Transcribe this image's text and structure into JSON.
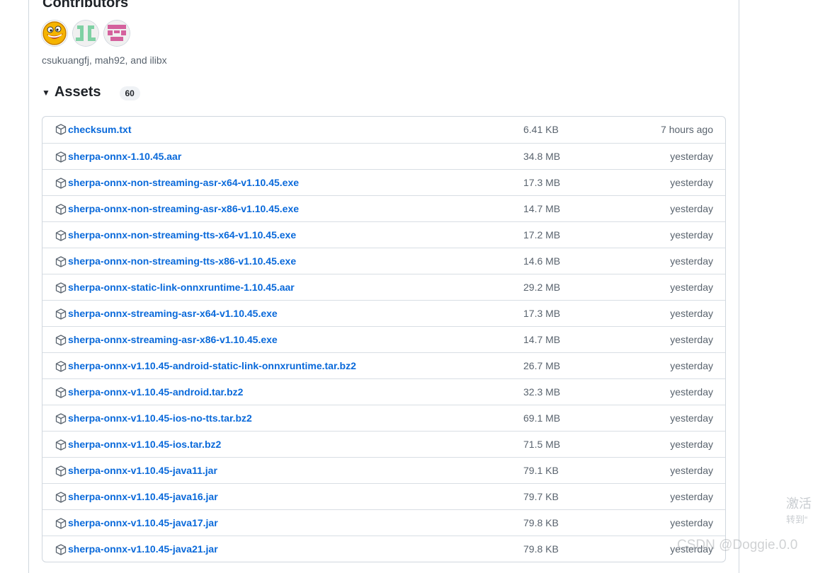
{
  "contributors": {
    "title": "Contributors",
    "names": "csukuangfj, mah92, and ilibx",
    "avatars": [
      {
        "name": "smiley-avatar",
        "color": "#f5b400"
      },
      {
        "name": "green-pattern-avatar",
        "color": "#7fd1a4"
      },
      {
        "name": "pink-pattern-avatar",
        "color": "#d4619d"
      }
    ]
  },
  "assets": {
    "title": "Assets",
    "count": "60",
    "caret_icon": "triangle-down-icon",
    "row_icon": "package-icon",
    "link_color": "#0969da",
    "items": [
      {
        "name": "checksum.txt",
        "size": "6.41 KB",
        "date": "7 hours ago"
      },
      {
        "name": "sherpa-onnx-1.10.45.aar",
        "size": "34.8 MB",
        "date": "yesterday"
      },
      {
        "name": "sherpa-onnx-non-streaming-asr-x64-v1.10.45.exe",
        "size": "17.3 MB",
        "date": "yesterday"
      },
      {
        "name": "sherpa-onnx-non-streaming-asr-x86-v1.10.45.exe",
        "size": "14.7 MB",
        "date": "yesterday"
      },
      {
        "name": "sherpa-onnx-non-streaming-tts-x64-v1.10.45.exe",
        "size": "17.2 MB",
        "date": "yesterday"
      },
      {
        "name": "sherpa-onnx-non-streaming-tts-x86-v1.10.45.exe",
        "size": "14.6 MB",
        "date": "yesterday"
      },
      {
        "name": "sherpa-onnx-static-link-onnxruntime-1.10.45.aar",
        "size": "29.2 MB",
        "date": "yesterday"
      },
      {
        "name": "sherpa-onnx-streaming-asr-x64-v1.10.45.exe",
        "size": "17.3 MB",
        "date": "yesterday"
      },
      {
        "name": "sherpa-onnx-streaming-asr-x86-v1.10.45.exe",
        "size": "14.7 MB",
        "date": "yesterday"
      },
      {
        "name": "sherpa-onnx-v1.10.45-android-static-link-onnxruntime.tar.bz2",
        "size": "26.7 MB",
        "date": "yesterday"
      },
      {
        "name": "sherpa-onnx-v1.10.45-android.tar.bz2",
        "size": "32.3 MB",
        "date": "yesterday"
      },
      {
        "name": "sherpa-onnx-v1.10.45-ios-no-tts.tar.bz2",
        "size": "69.1 MB",
        "date": "yesterday"
      },
      {
        "name": "sherpa-onnx-v1.10.45-ios.tar.bz2",
        "size": "71.5 MB",
        "date": "yesterday"
      },
      {
        "name": "sherpa-onnx-v1.10.45-java11.jar",
        "size": "79.1 KB",
        "date": "yesterday"
      },
      {
        "name": "sherpa-onnx-v1.10.45-java16.jar",
        "size": "79.7 KB",
        "date": "yesterday"
      },
      {
        "name": "sherpa-onnx-v1.10.45-java17.jar",
        "size": "79.8 KB",
        "date": "yesterday"
      },
      {
        "name": "sherpa-onnx-v1.10.45-java21.jar",
        "size": "79.8 KB",
        "date": "yesterday"
      }
    ]
  },
  "overlay": {
    "activate_line1": "激活",
    "activate_line2": "转到“",
    "watermark": "CSDN @Doggie.0.0"
  }
}
